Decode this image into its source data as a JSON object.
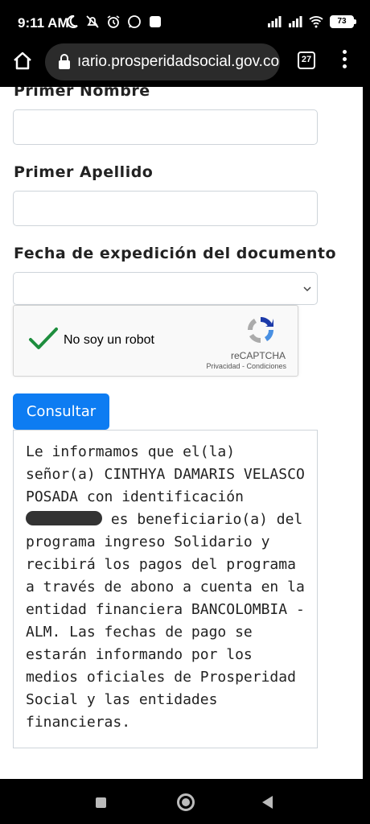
{
  "status_bar": {
    "time": "9:11 AM",
    "left_icons": [
      "moon-icon",
      "silent-icon",
      "alarm-icon",
      "whatsapp-icon",
      "notification-icon"
    ],
    "right_icons": [
      "signal-icon",
      "signal-icon",
      "wifi-icon"
    ],
    "battery": "73"
  },
  "browser": {
    "url": "ıario.prosperidadsocial.gov.co",
    "tab_count": "27"
  },
  "form": {
    "first_name_label": "Primer Nombre",
    "first_surname_label": "Primer Apellido",
    "expedition_date_label": "Fecha de expedición del documento",
    "first_name_value": "",
    "first_surname_value": "",
    "expedition_date_value": ""
  },
  "captcha": {
    "label": "No soy un robot",
    "brand": "reCAPTCHA",
    "links": "Privacidad - Condiciones",
    "checked": true
  },
  "consult_button": "Consultar",
  "result": {
    "part1": "Le informamos que el(la) señor(a) CINTHYA DAMARIS VELASCO POSADA con identificación ",
    "part2": " es beneficiario(a) del programa ingreso Solidario y recibirá los pagos del programa a través de abono a cuenta en la entidad financiera BANCOLOMBIA - ALM. Las fechas de pago se estarán informando por los medios oficiales de Prosperidad Social y las entidades financieras."
  },
  "colors": {
    "primary": "#0d7cf2",
    "check": "#1e8e3e"
  }
}
